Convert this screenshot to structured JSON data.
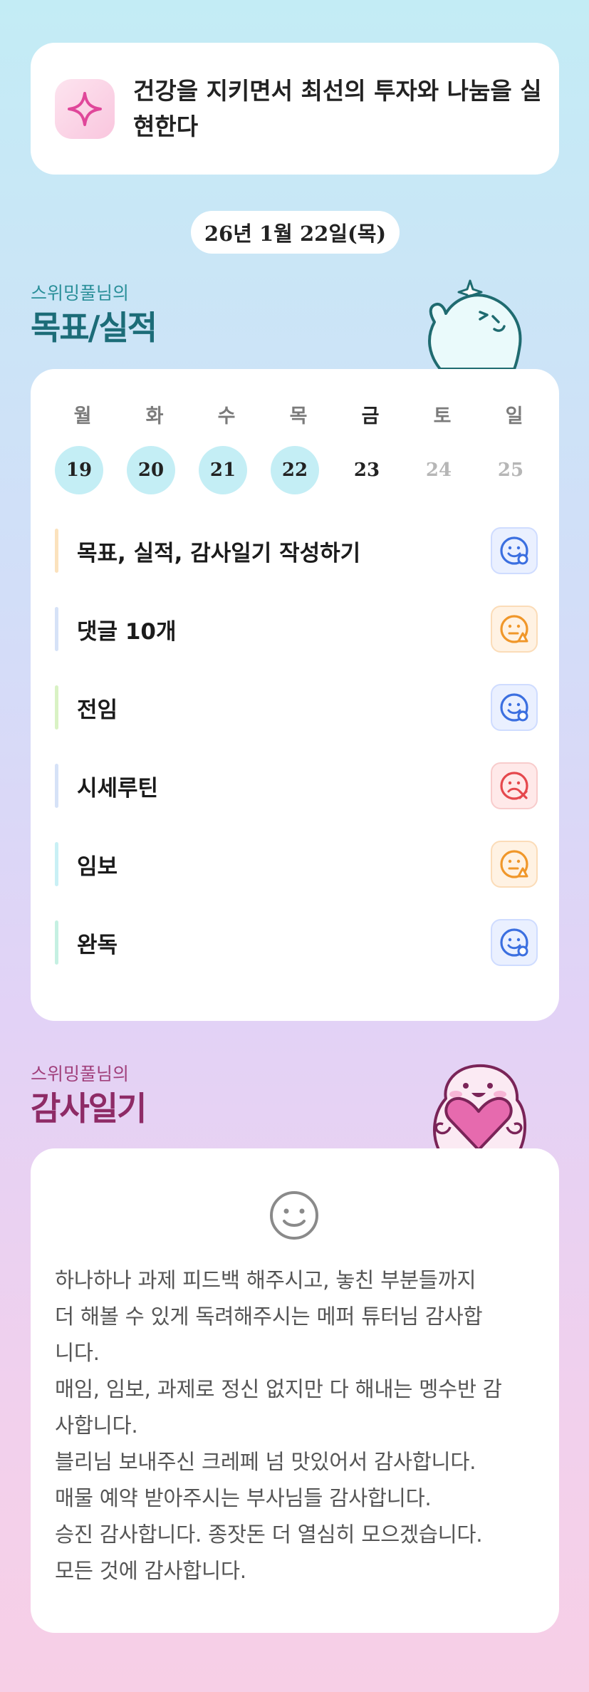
{
  "goal": {
    "lines": [
      "건강을 지키면서 최선의 투자와 나눔을 실",
      "현한다"
    ],
    "icon": "sparkle-icon"
  },
  "date_label": "26년 1월 22일(목)",
  "goals_section": {
    "subtitle": "스위밍풀님의",
    "title": "목표/실적"
  },
  "week": {
    "weekdays": [
      "월",
      "화",
      "수",
      "목",
      "금",
      "토",
      "일"
    ],
    "days": [
      "19",
      "20",
      "21",
      "22",
      "23",
      "24",
      "25"
    ],
    "today_index": 4
  },
  "tasks": [
    {
      "label": "목표, 실적, 감사일기 작성하기",
      "status": "good",
      "status_icon": "smile-face-icon",
      "bar_color": "#fbe2bd"
    },
    {
      "label": "댓글 10개",
      "status": "mid",
      "status_icon": "neutral-face-icon",
      "bar_color": "#d6e2f7"
    },
    {
      "label": "전임",
      "status": "good",
      "status_icon": "smile-face-icon",
      "bar_color": "#d9f2c4"
    },
    {
      "label": "시세루틴",
      "status": "bad",
      "status_icon": "sad-face-icon",
      "bar_color": "#d6e2f7"
    },
    {
      "label": "임보",
      "status": "mid",
      "status_icon": "neutral-face-icon",
      "bar_color": "#c9f0f5"
    },
    {
      "label": "완독",
      "status": "good",
      "status_icon": "smile-face-icon",
      "bar_color": "#c5f0e2"
    }
  ],
  "status_colors": {
    "good": "#3b6fe0",
    "mid": "#f0972a",
    "bad": "#e5484d"
  },
  "journal_section": {
    "subtitle": "스위밍풀님의",
    "title": "감사일기"
  },
  "journal": {
    "mood_icon": "smile-face-icon",
    "lines": [
      "하나하나 과제 피드백 해주시고, 놓친 부분들까지",
      "더 해볼 수 있게 독려해주시는 메퍼 튜터님 감사합",
      "니다.",
      "매임, 임보, 과제로 정신 없지만 다 해내는 멩수반 감",
      "사합니다.",
      "블리님 보내주신 크레페 넘 맛있어서 감사합니다.",
      "매물 예약 받아주시는 부사님들 감사합니다.",
      "승진 감사합니다. 종잣돈 더 열심히 모으겠습니다.",
      "모든 것에 감사합니다."
    ]
  },
  "colors": {
    "goals_title": "#1c6c78",
    "goals_subtitle": "#2a8f99",
    "journal_title": "#8e2b66",
    "journal_subtitle": "#a1407c",
    "day_done_bg": "#c4eef5"
  }
}
